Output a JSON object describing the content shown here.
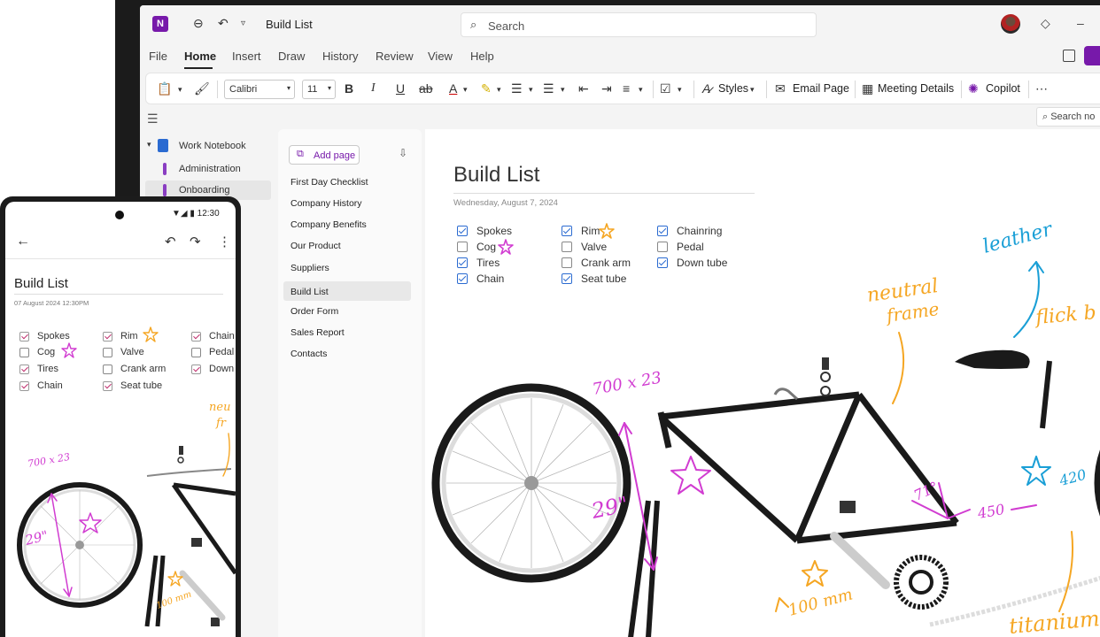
{
  "titlebar": {
    "app_icon_label": "N",
    "back_icon": "back-icon",
    "undo_icon": "undo-icon",
    "doc_title": "Build List",
    "search_placeholder": "Search"
  },
  "menu": {
    "tabs": [
      {
        "label": "File"
      },
      {
        "label": "Home"
      },
      {
        "label": "Insert"
      },
      {
        "label": "Draw"
      },
      {
        "label": "History"
      },
      {
        "label": "Review"
      },
      {
        "label": "View"
      },
      {
        "label": "Help"
      }
    ],
    "active_tab": "Home"
  },
  "ribbon": {
    "font_name": "Calibri",
    "font_size": "11",
    "bold": "B",
    "italic": "I",
    "underline": "U",
    "strike": "ab",
    "font_color": "A",
    "styles_label": "Styles",
    "email_page_label": "Email Page",
    "meeting_details_label": "Meeting Details",
    "copilot_label": "Copilot",
    "search_notes_placeholder": "Search no"
  },
  "notebooks": {
    "items": [
      {
        "label": "Work Notebook",
        "type": "notebook"
      },
      {
        "label": "Administration",
        "type": "section"
      },
      {
        "label": "Onboarding",
        "type": "section",
        "selected": true
      }
    ]
  },
  "pages": {
    "add_page_label": "Add page",
    "items": [
      {
        "label": "First Day Checklist"
      },
      {
        "label": "Company History"
      },
      {
        "label": "Company Benefits"
      },
      {
        "label": "Our Product"
      },
      {
        "label": "Suppliers"
      },
      {
        "label": "Build List",
        "selected": true
      },
      {
        "label": "Order Form"
      },
      {
        "label": "Sales Report"
      },
      {
        "label": "Contacts"
      }
    ]
  },
  "note": {
    "title": "Build List",
    "date": "Wednesday, August 7, 2024",
    "checklist": [
      {
        "label": "Spokes",
        "checked": true
      },
      {
        "label": "Cog",
        "checked": false
      },
      {
        "label": "Tires",
        "checked": true
      },
      {
        "label": "Chain",
        "checked": true
      },
      {
        "label": "Rim",
        "checked": true
      },
      {
        "label": "Valve",
        "checked": false
      },
      {
        "label": "Crank arm",
        "checked": false
      },
      {
        "label": "Seat tube",
        "checked": true
      },
      {
        "label": "Chainring",
        "checked": true
      },
      {
        "label": "Pedal",
        "checked": false
      },
      {
        "label": "Down tube",
        "checked": true
      }
    ],
    "ink": {
      "leather": "leather",
      "neutral_frame_1": "neutral",
      "neutral_frame_2": "frame",
      "flick": "flick b",
      "size": "700 x 23",
      "diameter": "29\"",
      "angle": "71°",
      "length_450": "450",
      "length_420": "420",
      "crank": "100 mm",
      "titanium": "titanium"
    }
  },
  "phone": {
    "status": "▼◢ ▮ 12:30",
    "title": "Build List",
    "date": "07 August 2024    12:30PM",
    "checklist": [
      {
        "label": "Spokes",
        "checked": true
      },
      {
        "label": "Cog",
        "checked": false
      },
      {
        "label": "Tires",
        "checked": true
      },
      {
        "label": "Chain",
        "checked": true
      },
      {
        "label": "Rim",
        "checked": true
      },
      {
        "label": "Valve",
        "checked": false
      },
      {
        "label": "Crank arm",
        "checked": false
      },
      {
        "label": "Seat tube",
        "checked": true
      },
      {
        "label": "Chain",
        "checked": true
      },
      {
        "label": "Pedal",
        "checked": false
      },
      {
        "label": "Down",
        "checked": true
      }
    ],
    "ink": {
      "size": "700 x 23",
      "diameter": "29\"",
      "crank": "100 mm",
      "neutral_1": "neu",
      "neutral_2": "fr"
    }
  },
  "colors": {
    "onenote_purple": "#7719aa",
    "ink_magenta": "#d13cd1",
    "ink_orange": "#f5a623",
    "ink_blue": "#1a9fd6",
    "check_blue": "#2b6bd1"
  }
}
